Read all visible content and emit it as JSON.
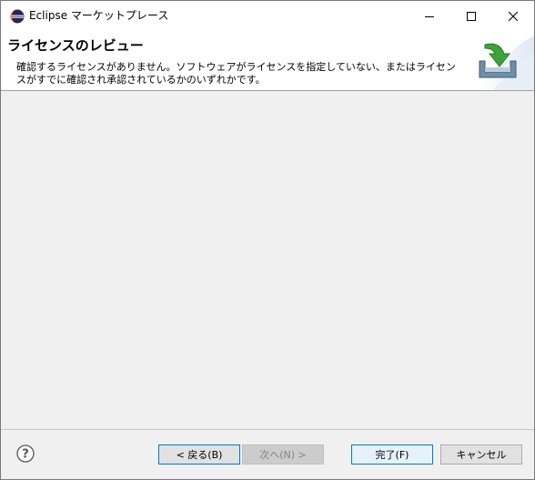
{
  "window": {
    "title": "Eclipse マーケットプレース"
  },
  "header": {
    "title": "ライセンスのレビュー",
    "message": "確認するライセンスがありません。ソフトウェアがライセンスを指定していない、またはライセンスがすでに確認され承認されているかのいずれかです。"
  },
  "footer": {
    "back_label": "< 戻る(B)",
    "next_label": "次へ(N) >",
    "finish_label": "完了(F)",
    "cancel_label": "キャンセル"
  },
  "colors": {
    "accent": "#0078d7",
    "install_arrow": "#3da33d",
    "eclipse_blue": "#2c2255"
  }
}
